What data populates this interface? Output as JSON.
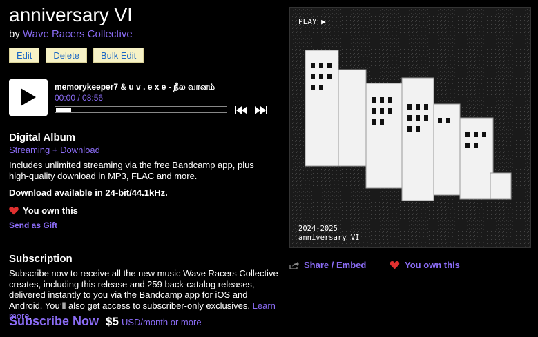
{
  "album": {
    "title": "anniversary VI",
    "by_label": "by",
    "artist": "Wave Racers Collective"
  },
  "buttons": {
    "edit": "Edit",
    "delete": "Delete",
    "bulk_edit": "Bulk Edit"
  },
  "player": {
    "track_title": "memorykeeper7 & u v . e x e - நீல வானம்",
    "time": "00:00 / 08:56",
    "progress_fraction": 0.09
  },
  "digital_album": {
    "heading": "Digital Album",
    "sub": "Streaming + Download",
    "description": "Includes unlimited streaming via the free Bandcamp app, plus high-quality download in MP3, FLAC and more.",
    "download_note": "Download available in 24-bit/44.1kHz.",
    "owned_label": "You own this",
    "gift_link": "Send as Gift"
  },
  "subscription": {
    "heading": "Subscription",
    "description": "Subscribe now to receive all the new music Wave Racers Collective creates, including this release and 259 back-catalog releases, delivered instantly to you via the Bandcamp app for iOS and Android. You’ll also get access to subscriber-only exclusives.",
    "learn_more": "Learn more",
    "period": ".",
    "subscribe_label": "Subscribe Now",
    "price": "$5",
    "price_suffix": "USD/month or more"
  },
  "cover": {
    "play_label": "PLAY ▶",
    "year_text": "2024-2025",
    "name_text": "anniversary VI"
  },
  "share": {
    "label": "Share / Embed"
  },
  "own_right": {
    "label": "You own this"
  },
  "colors": {
    "accent": "#8b6cf5",
    "heart": "#e0302f",
    "button_bg": "#f7f2c6",
    "button_text": "#1a66c4"
  }
}
